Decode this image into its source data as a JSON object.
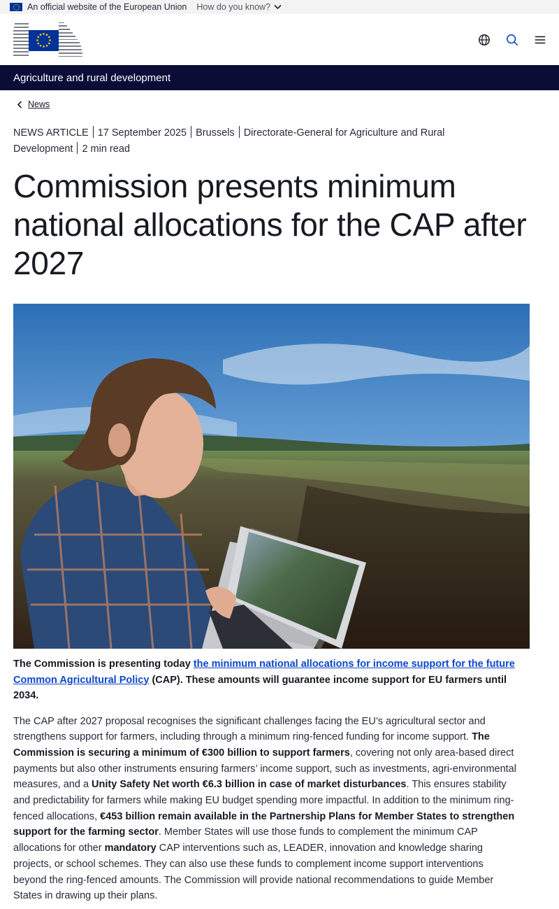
{
  "topbar": {
    "official_text": "An official website of the European Union",
    "how_text": "How do you know?"
  },
  "header": {
    "icons": [
      "globe-icon",
      "search-icon",
      "menu-icon"
    ],
    "accent_color": "#0e47cb"
  },
  "site_bar": {
    "title": "Agriculture and rural development",
    "bg_color": "#0b0d38"
  },
  "breadcrumb": {
    "back_label": "News"
  },
  "meta": {
    "type": "NEWS ARTICLE",
    "date": "17 September 2025",
    "place": "Brussels",
    "department": "Directorate-General for Agriculture and Rural Development",
    "read_time": "2 min read"
  },
  "article": {
    "title": "Commission presents minimum national allocations for the CAP after 2027",
    "lead": {
      "p1": "The Commission is presenting today ",
      "link": "the minimum national allocations for income support for the future Common Agricultural Policy",
      "p2": " (CAP). These amounts will guarantee income support for EU farmers until 2034."
    },
    "body": {
      "s1": "The CAP after 2027 proposal recognises the significant challenges facing the EU’s agricultural sector and strengthens support for farmers, including through a minimum ring-fenced funding for income support. ",
      "b1": "The Commission is securing a minimum of €300 billion to support farmers",
      "s2": ", covering not only area-based direct payments but also other instruments ensuring farmers’ income support, such as investments, agri-environmental measures, and a ",
      "b2": "Unity Safety Net worth €6.3 billion in case of market disturbances",
      "s3": ". This ensures stability and predictability for farmers while making EU budget spending more impactful. In addition to the minimum ring-fenced allocations, ",
      "b3": "€453 billion remain available in the Partnership Plans for Member States to strengthen support for the farming sector",
      "s4": ". Member States will use those funds to complement the minimum CAP allocations for other ",
      "b4": "mandatory",
      "s5": " CAP interventions such as, LEADER, innovation and knowledge sharing projects, or school schemes. They can also use these funds to complement income support interventions beyond the ring-fenced amounts. The Commission will provide national recommendations to guide Member States in drawing up their plans."
    }
  }
}
